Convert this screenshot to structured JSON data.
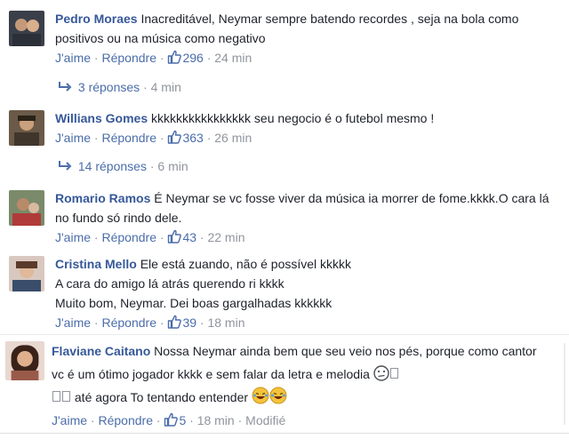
{
  "ui": {
    "like": "J'aime",
    "reply": "Répondre",
    "sep": "·"
  },
  "comments": [
    {
      "author": "Pedro Moraes",
      "text": "Inacreditável, Neymar sempre batendo recordes , seja na bola como positivos ou na música como negativo",
      "likes": "296",
      "time": "24 min",
      "replies": {
        "label": "3 réponses",
        "time": "4 min"
      }
    },
    {
      "author": "Willians Gomes",
      "text": "kkkkkkkkkkkkkkkk seu negocio é o futebol mesmo !",
      "likes": "363",
      "time": "26 min",
      "replies": {
        "label": "14 réponses",
        "time": "6 min"
      }
    },
    {
      "author": "Romario Ramos",
      "text": "É Neymar se vc fosse viver da música ia morrer de fome.kkkk.O cara lá no fundo só rindo dele.",
      "likes": "43",
      "time": "22 min"
    },
    {
      "author": "Cristina Mello",
      "text": "Ele está zuando, não é possível kkkkk",
      "line2": "A cara do amigo lá atrás querendo ri kkkk",
      "line3": "Muito bom, Neymar. Dei boas gargalhadas kkkkkk",
      "likes": "39",
      "time": "18 min"
    },
    {
      "author": "Flaviane Caitano",
      "text": "Nossa Neymar ainda bem que seu veio nos pés, porque como cantor vc é um ótimo jogador kkkk e sem falar da letra e melodia",
      "text_end": "até agora To tentando entender",
      "likes": "5",
      "time": "18 min",
      "edited": "Modifié"
    }
  ],
  "colors": {
    "author": "#365899",
    "link": "#4b6daa",
    "muted": "#90949c",
    "text": "#1d2129"
  },
  "icons": [
    "thumbs-up-icon",
    "reply-arrow-icon",
    "confused-face-icon",
    "laughing-face-icon"
  ]
}
